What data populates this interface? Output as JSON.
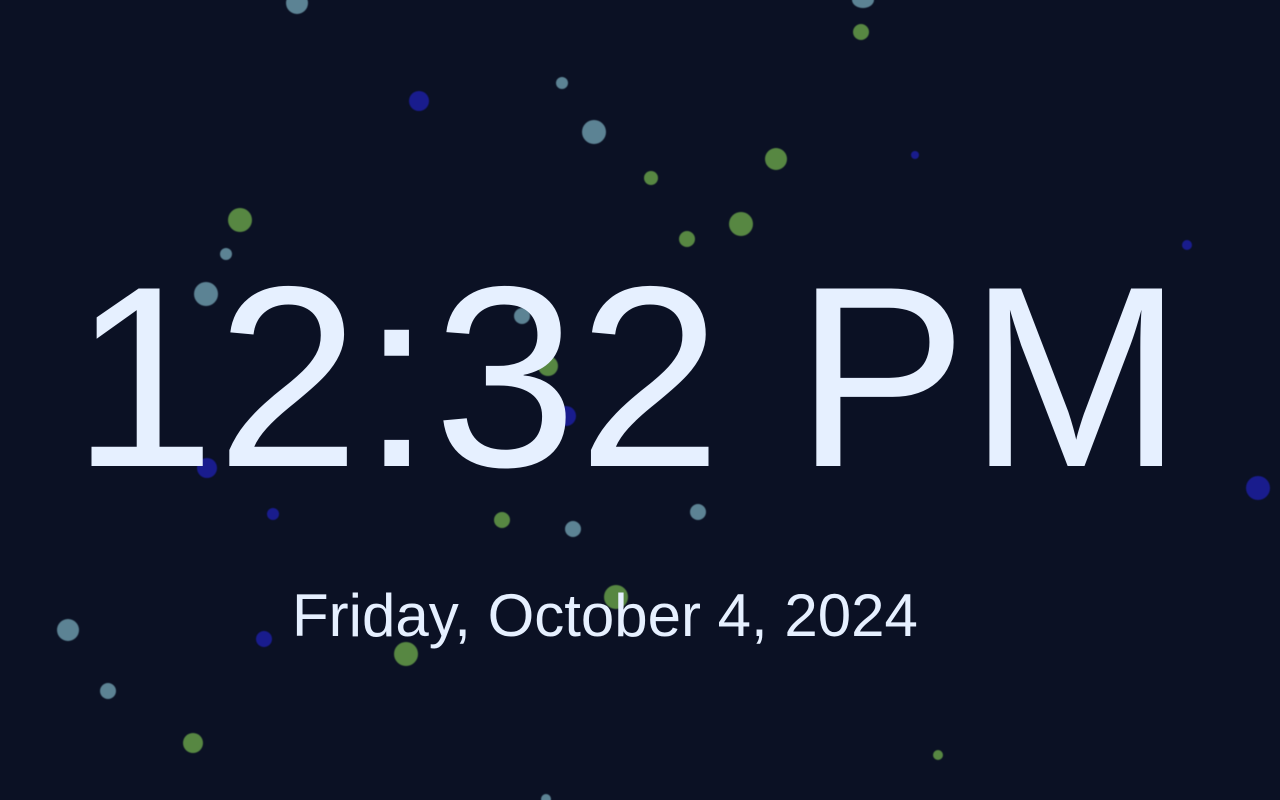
{
  "clock": {
    "time": "12:32 PM",
    "date": "Friday, October 4, 2024"
  },
  "colors": {
    "background": "#0b1124",
    "text": "#e6f0ff",
    "particle_teal": "#78aab9",
    "particle_green": "#78b950",
    "particle_blue": "#1c1ea0"
  }
}
